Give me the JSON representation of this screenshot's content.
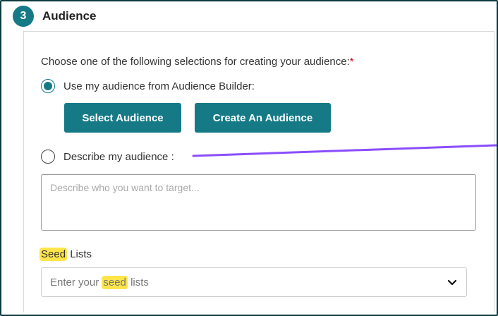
{
  "step": {
    "number": "3",
    "title": "Audience"
  },
  "prompt": {
    "text": "Choose one of the following selections for creating your audience:",
    "required_mark": "*"
  },
  "options": [
    {
      "label": "Use my audience from Audience Builder:",
      "checked": true
    },
    {
      "label": "Describe my audience :",
      "checked": false
    }
  ],
  "buttons": {
    "select_label": "Select Audience",
    "create_label": "Create An Audience"
  },
  "description": {
    "placeholder": "Describe who you want to target..."
  },
  "seed_lists": {
    "label_highlight": "Seed",
    "label_rest": " Lists",
    "placeholder_before": "Enter your ",
    "placeholder_highlight": "seed",
    "placeholder_after": " lists"
  },
  "icons": {
    "dropdown": "chevron-down-icon"
  },
  "colors": {
    "accent": "#157a86",
    "highlight": "#ffe54a",
    "annotation": "#8a4dff",
    "required": "#d0021b"
  }
}
